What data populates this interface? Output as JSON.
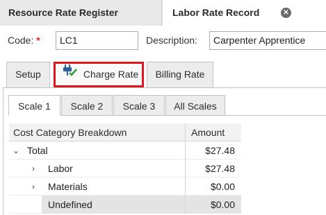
{
  "doc_tabs": [
    {
      "label": "Resource Rate Register"
    },
    {
      "label": "Labor Rate Record"
    }
  ],
  "form": {
    "code_label": "Code:",
    "required_marker": "*",
    "code_value": "LC1",
    "description_label": "Description:",
    "description_value": "Carpenter Apprentice"
  },
  "outer_tabs": [
    {
      "label": "Setup"
    },
    {
      "label": "Charge Rate"
    },
    {
      "label": "Billing Rate"
    }
  ],
  "scale_tabs": [
    {
      "label": "Scale 1"
    },
    {
      "label": "Scale 2"
    },
    {
      "label": "Scale 3"
    },
    {
      "label": "All Scales"
    }
  ],
  "grid": {
    "headers": {
      "category": "Cost Category Breakdown",
      "amount": "Amount"
    },
    "rows": [
      {
        "name": "Total",
        "amount": "$27.48"
      },
      {
        "name": "Labor",
        "amount": "$27.48"
      },
      {
        "name": "Materials",
        "amount": "$0.00"
      },
      {
        "name": "Undefined",
        "amount": "$0.00"
      }
    ]
  },
  "colors": {
    "highlight": "#e3141b",
    "icon_blue": "#2f5f9e",
    "icon_green": "#2e9a3e"
  }
}
